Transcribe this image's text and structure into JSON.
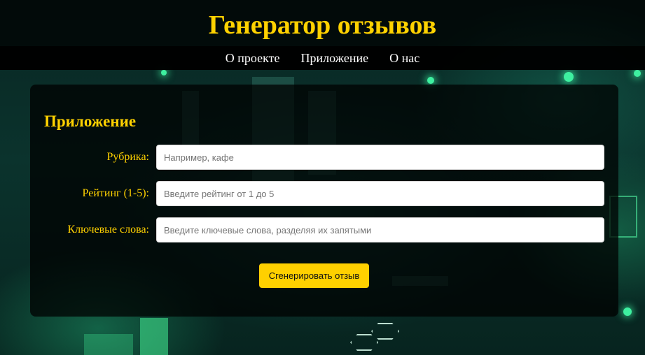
{
  "header": {
    "title": "Генератор отзывов",
    "nav": [
      {
        "label": "О проекте"
      },
      {
        "label": "Приложение"
      },
      {
        "label": "О нас"
      }
    ]
  },
  "app": {
    "title": "Приложение",
    "fields": {
      "category": {
        "label": "Рубрика:",
        "placeholder": "Например, кафе",
        "value": ""
      },
      "rating": {
        "label": "Рейтинг (1-5):",
        "placeholder": "Введите рейтинг от 1 до 5",
        "value": ""
      },
      "keywords": {
        "label": "Ключевые слова:",
        "placeholder": "Введите ключевые слова, разделяя их запятыми",
        "value": ""
      }
    },
    "generate_label": "Сгенерировать отзыв"
  },
  "colors": {
    "accent": "#ffd200",
    "panel_bg": "#000000",
    "nav_text": "#ffffff"
  }
}
